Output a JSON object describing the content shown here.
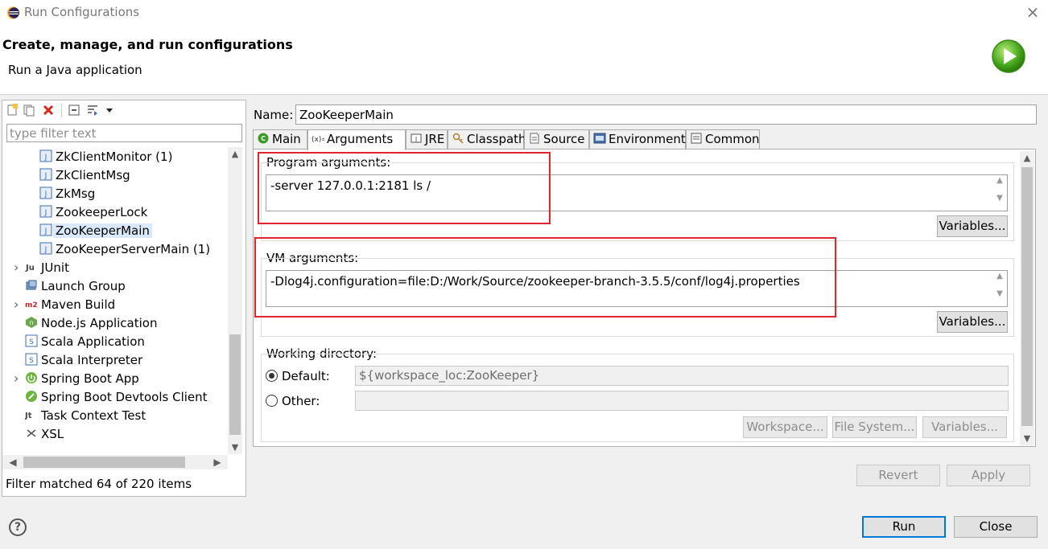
{
  "window": {
    "title": "Run Configurations",
    "close_icon": "×"
  },
  "header": {
    "title": "Create, manage, and run configurations",
    "subtitle": "Run a Java application"
  },
  "left": {
    "filter_placeholder": "type filter text",
    "tree": [
      {
        "label": "ZkClientMonitor (1)",
        "icon": "java-class-icon",
        "level": 1
      },
      {
        "label": "ZkClientMsg",
        "icon": "java-class-icon",
        "level": 1
      },
      {
        "label": "ZkMsg",
        "icon": "java-class-icon",
        "level": 1
      },
      {
        "label": "ZookeeperLock",
        "icon": "java-class-icon",
        "level": 1
      },
      {
        "label": "ZooKeeperMain",
        "icon": "java-class-icon",
        "level": 1,
        "selected": true
      },
      {
        "label": "ZooKeeperServerMain (1)",
        "icon": "java-class-icon",
        "level": 1
      },
      {
        "label": "JUnit",
        "icon": "junit-icon",
        "level": 0,
        "expandable": true
      },
      {
        "label": "Launch Group",
        "icon": "launch-group-icon",
        "level": 0
      },
      {
        "label": "Maven Build",
        "icon": "maven-icon",
        "level": 0,
        "expandable": true
      },
      {
        "label": "Node.js Application",
        "icon": "nodejs-icon",
        "level": 0
      },
      {
        "label": "Scala Application",
        "icon": "scala-app-icon",
        "level": 0
      },
      {
        "label": "Scala Interpreter",
        "icon": "scala-interpreter-icon",
        "level": 0
      },
      {
        "label": "Spring Boot App",
        "icon": "spring-boot-icon",
        "level": 0,
        "expandable": true
      },
      {
        "label": "Spring Boot Devtools Client",
        "icon": "spring-devtools-icon",
        "level": 0
      },
      {
        "label": "Task Context Test",
        "icon": "task-context-icon",
        "level": 0
      },
      {
        "label": "XSL",
        "icon": "xsl-icon",
        "level": 0
      }
    ],
    "status": "Filter matched 64 of 220 items"
  },
  "config": {
    "name_label": "Name:",
    "name_value": "ZooKeeperMain",
    "tabs": [
      {
        "label": "Main",
        "icon": "main-tab-icon"
      },
      {
        "label": "Arguments",
        "icon": "arguments-tab-icon",
        "active": true
      },
      {
        "label": "JRE",
        "icon": "jre-tab-icon"
      },
      {
        "label": "Classpath",
        "icon": "classpath-tab-icon"
      },
      {
        "label": "Source",
        "icon": "source-tab-icon"
      },
      {
        "label": "Environment",
        "icon": "environment-tab-icon"
      },
      {
        "label": "Common",
        "icon": "common-tab-icon"
      }
    ],
    "program_args_label": "Program arguments:",
    "program_args": "-server 127.0.0.1:2181 ls /",
    "vm_args_label": "VM arguments:",
    "vm_args": "-Dlog4j.configuration=file:D:/Work/Source/zookeeper-branch-3.5.5/conf/log4j.properties",
    "variables_label": "Variables...",
    "working_dir_label": "Working directory:",
    "default_label": "Default:",
    "default_value": "${workspace_loc:ZooKeeper}",
    "other_label": "Other:",
    "workspace_btn": "Workspace...",
    "filesystem_btn": "File System...",
    "variables_btn": "Variables..."
  },
  "footer": {
    "revert": "Revert",
    "apply": "Apply",
    "run": "Run",
    "close": "Close",
    "help_icon": "?"
  },
  "colors": {
    "highlight_box": "#e0262d",
    "selection": "#d9e8fa",
    "focus_border": "#0078d7"
  }
}
